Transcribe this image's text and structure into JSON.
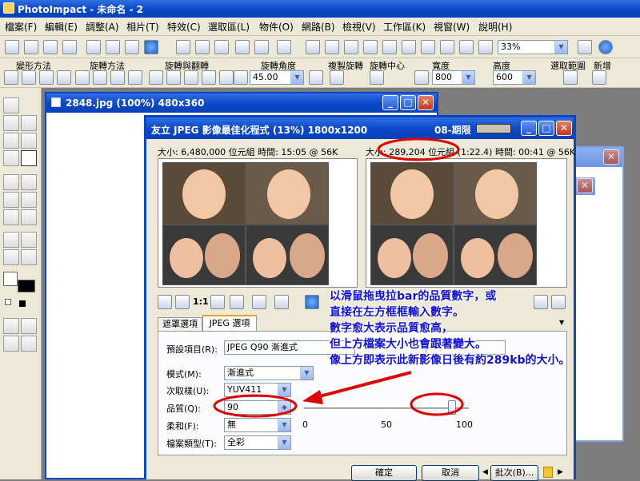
{
  "app": {
    "title": "PhotoImpact - 未命名 - 2"
  },
  "menu": [
    "檔案(F)",
    "編輯(E)",
    "調整(A)",
    "相片(T)",
    "特效(C)",
    "選取區(L)",
    "物件(O)",
    "網路(B)",
    "檢視(V)",
    "工作區(K)",
    "視窗(W)",
    "說明(H)"
  ],
  "toolbar": {
    "zoom": "33%"
  },
  "props": {
    "labels": [
      "變形方法",
      "旋轉方法",
      "旋轉與翻轉",
      "旋轉角度",
      "複製旋轉",
      "旋轉中心",
      "寬度",
      "高度",
      "選取範圍",
      "新增"
    ],
    "angle": "45.00",
    "width": "800",
    "height": "600"
  },
  "docwin": {
    "title": "2848.jpg (100%) 480x360"
  },
  "dialog": {
    "title": "友立 JPEG 影像最佳化程式 (13%) 1800x1200",
    "trial": "08-期限",
    "left_info": "大小: 6,480,000 位元組 時間: 15:05 @ 56K",
    "right_info_prefix": "大小: ",
    "right_size": "289,204 位元組",
    "right_info_suffix": " (1:22.4) 時間: 00:41 @ 56K",
    "tabs": [
      "遮罩選項",
      "JPEG 選項"
    ],
    "preset_label": "預設項目(R):",
    "preset_value": "JPEG Q90 漸進式",
    "mode_label": "模式(M):",
    "mode_value": "漸進式",
    "subsample_label": "次取樣(U):",
    "subsample_value": "YUV411",
    "quality_label": "品質(Q):",
    "quality_value": "90",
    "quality_level": 90,
    "smooth_label": "柔和(F):",
    "smooth_value": "無",
    "filetype_label": "檔案類型(T):",
    "filetype_value": "全彩",
    "scale": [
      "0",
      "50",
      "100"
    ],
    "ok": "確定",
    "cancel": "取消",
    "batch": "批次(B)..."
  },
  "annotation": {
    "lines": [
      "以滑鼠拖曳拉bar的品質數字，或",
      "直接在左方框框輸入數字。",
      "數字愈大表示品質愈高，",
      "但上方檔案大小也會跟著變大。",
      "像上方即表示此新影像日後有約289kb的大小。"
    ],
    "color": "#1010d8"
  },
  "colors": {
    "accent": "#0a46c8",
    "highlight": "#e00000"
  }
}
